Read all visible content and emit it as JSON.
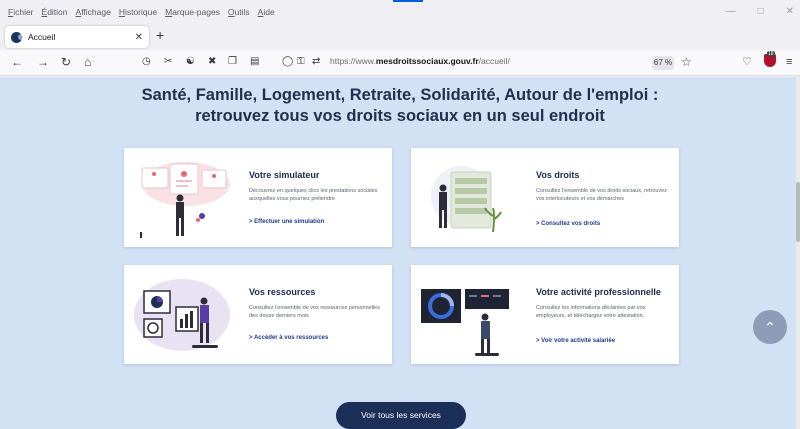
{
  "menubar": {
    "items": [
      "Fichier",
      "Édition",
      "Affichage",
      "Historique",
      "Marque-pages",
      "Outils",
      "Aide"
    ]
  },
  "tab": {
    "title": "Accueil"
  },
  "address": {
    "prefix": "https://www.",
    "host": "mesdroitssociaux.gouv.fr",
    "path": "/accueil/",
    "zoom": "67 %"
  },
  "extension": {
    "badge": "18"
  },
  "page": {
    "headline_line1": "Santé, Famille, Logement, Retraite, Solidarité, Autour de l'emploi :",
    "headline_line2": "retrouvez tous vos droits sociaux en un seul endroit",
    "cards": [
      {
        "title": "Votre simulateur",
        "desc": "Découvrez en quelques clics les prestations sociales auxquelles vous pourriez prétendre",
        "link": "> Effectuer une simulation"
      },
      {
        "title": "Vos droits",
        "desc": "Consultez l'ensemble de vos droits sociaux, retrouvez vos interlocuteurs et vos démarches",
        "link": "> Consultez vos droits"
      },
      {
        "title": "Vos ressources",
        "desc": "Consultez l'ensemble de vos ressources personnelles des douze derniers mois",
        "link": "> Accéder à vos ressources"
      },
      {
        "title": "Votre activité professionnelle",
        "desc": "Consultez les informations déclarées par vos employeurs, et téléchargez votre attestation.",
        "link": "> Voir votre activité salariée"
      }
    ],
    "cta": "Voir tous les services"
  },
  "colors": {
    "page_bg": "#d3e1f5",
    "navy": "#1b2f59",
    "link": "#1f3a8a",
    "accent_purple": "#5b3ba8"
  }
}
